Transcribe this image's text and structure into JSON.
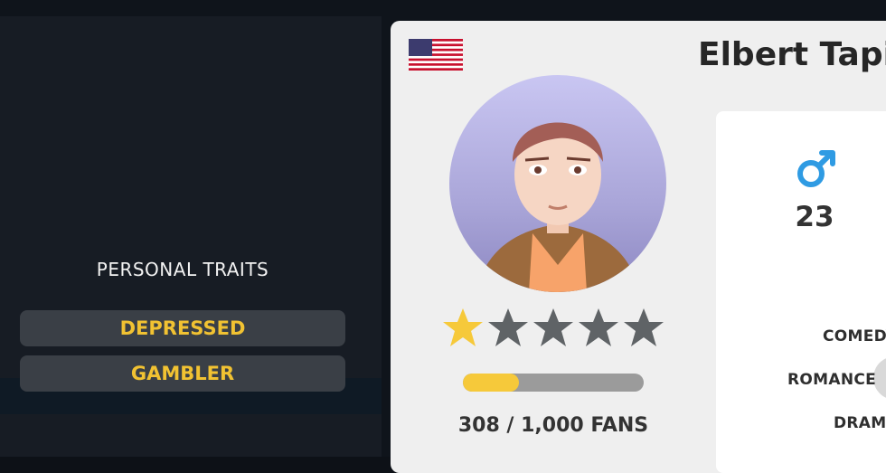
{
  "traits": {
    "title": "PERSONAL TRAITS",
    "items": [
      {
        "label": "DEPRESSED"
      },
      {
        "label": "GAMBLER"
      }
    ]
  },
  "profile": {
    "name": "Elbert Tapic",
    "country_flag": "us-flag-icon",
    "rating": {
      "value": 1,
      "max": 5
    },
    "fans": {
      "text": "308 / 1,000 FANS",
      "current": 308,
      "target": 1000
    },
    "gender_icon": "male-icon",
    "age": "23"
  },
  "genres": [
    {
      "label": "COMEDY"
    },
    {
      "label": "ROMANCE"
    },
    {
      "label": "DRAMA"
    }
  ],
  "colors": {
    "accent": "#f1c232",
    "star_active": "#f6c93a",
    "star_inactive": "#5f6366",
    "gender": "#2f9be3"
  }
}
